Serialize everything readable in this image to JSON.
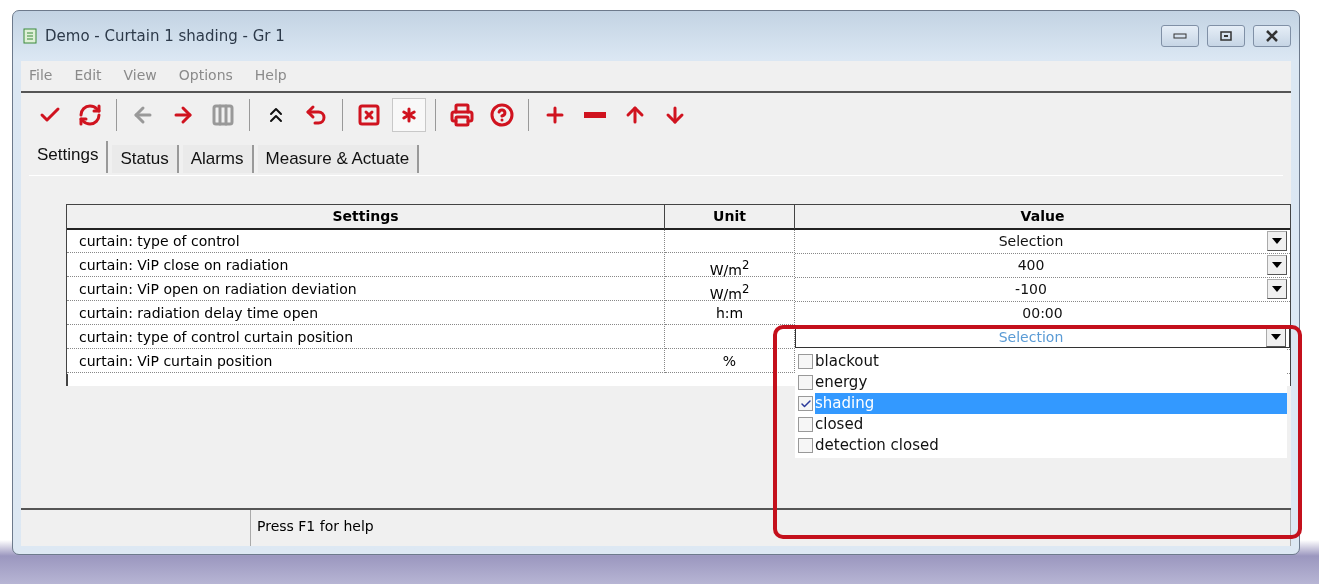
{
  "window": {
    "title": "Demo - Curtain 1 shading - Gr 1"
  },
  "menu": [
    "File",
    "Edit",
    "View",
    "Options",
    "Help"
  ],
  "toolbar": [
    {
      "kind": "check",
      "pressed": false,
      "disabled": false
    },
    {
      "kind": "refresh",
      "pressed": false,
      "disabled": false
    },
    {
      "kind": "sep"
    },
    {
      "kind": "left",
      "pressed": false,
      "disabled": true
    },
    {
      "kind": "right",
      "pressed": false,
      "disabled": false
    },
    {
      "kind": "grid",
      "pressed": false,
      "disabled": true
    },
    {
      "kind": "sep"
    },
    {
      "kind": "chevrons",
      "pressed": false,
      "disabled": false
    },
    {
      "kind": "undo",
      "pressed": false,
      "disabled": false
    },
    {
      "kind": "sep"
    },
    {
      "kind": "xbox",
      "pressed": false,
      "disabled": false
    },
    {
      "kind": "asterisk",
      "pressed": true,
      "disabled": false
    },
    {
      "kind": "sep"
    },
    {
      "kind": "print",
      "pressed": false,
      "disabled": false
    },
    {
      "kind": "help",
      "pressed": false,
      "disabled": false
    },
    {
      "kind": "sep"
    },
    {
      "kind": "plus",
      "pressed": false,
      "disabled": false
    },
    {
      "kind": "minus",
      "pressed": false,
      "disabled": false
    },
    {
      "kind": "up",
      "pressed": false,
      "disabled": false
    },
    {
      "kind": "down",
      "pressed": false,
      "disabled": false
    }
  ],
  "tabs": [
    {
      "label": "Settings",
      "selected": true
    },
    {
      "label": "Status",
      "selected": false
    },
    {
      "label": "Alarms",
      "selected": false
    },
    {
      "label": "Measure & Actuate",
      "selected": false
    }
  ],
  "table": {
    "columns": [
      "Settings",
      "Unit",
      "Value"
    ],
    "rows": [
      {
        "setting": "curtain: type of control",
        "value": "Selection",
        "dropdown": true,
        "editing": false
      },
      {
        "setting": "curtain: ViP close on radiation",
        "unit": "W/m$^{2}$",
        "value": "400",
        "dropdown": true,
        "editing": false
      },
      {
        "setting": "curtain: ViP open on radiation deviation",
        "unit": "W/m$^{2}$",
        "value": "-100",
        "dropdown": true,
        "editing": false
      },
      {
        "setting": "curtain: radiation delay time open",
        "unit": "h:m",
        "value": "00:00",
        "dropdown": false,
        "editing": false
      },
      {
        "setting": "curtain: type of control curtain position",
        "value": "Selection",
        "dropdown": true,
        "editing": true,
        "options": [
          {
            "label": "blackout",
            "checked": false,
            "selected": false
          },
          {
            "label": "energy",
            "checked": false,
            "selected": false
          },
          {
            "label": "shading",
            "checked": true,
            "selected": true
          },
          {
            "label": "closed",
            "checked": false,
            "selected": false
          },
          {
            "label": "detection closed",
            "checked": false,
            "selected": false
          }
        ]
      },
      {
        "setting": "curtain: ViP curtain position",
        "unit": "%",
        "editing": false
      }
    ]
  },
  "status_bar": [
    "Press F1 for help"
  ]
}
